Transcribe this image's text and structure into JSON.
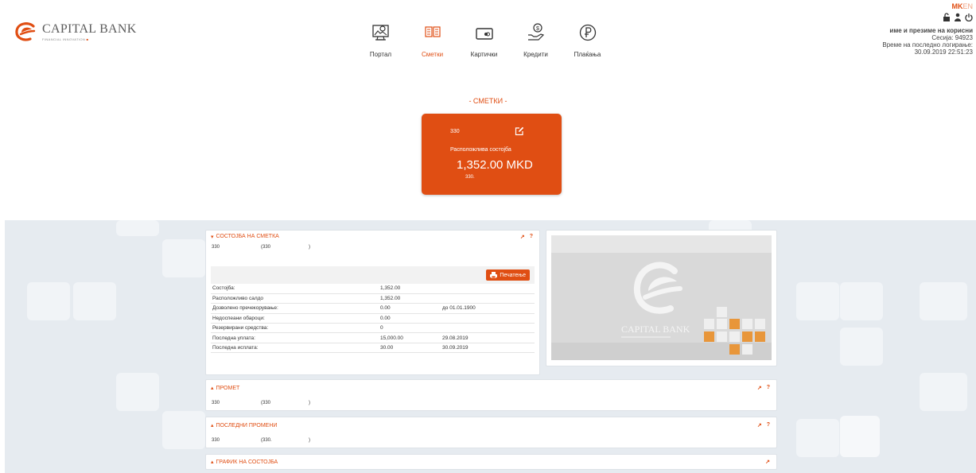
{
  "brand": {
    "name": "CAPITAL BANK",
    "tagline": "FINANCIAL INNOVATION",
    "accent": "#e04e13"
  },
  "nav": {
    "items": [
      {
        "label": "Портал",
        "icon": "portal-icon",
        "active": false
      },
      {
        "label": "Сметки",
        "icon": "accounts-icon",
        "active": true
      },
      {
        "label": "Картички",
        "icon": "card-icon",
        "active": false
      },
      {
        "label": "Кредити",
        "icon": "loan-icon",
        "active": false
      },
      {
        "label": "Плаќања",
        "icon": "payment-icon",
        "active": false
      }
    ]
  },
  "user": {
    "lang_mk": "MK",
    "lang_en": "EN",
    "name": "име и презиме на корисни",
    "session": "Сесија: 94923",
    "last_login_label": "Време на последно логирање:",
    "last_login_value": "30.09.2019 22:51:23"
  },
  "section_title": "- СМЕТКИ -",
  "account_card": {
    "number": "330",
    "label": "Расположлива состојба",
    "balance": "1,352.00 MKD",
    "sub": "330."
  },
  "balance_panel": {
    "title": "СОСТОЈБА НА СМЕТКА",
    "acct_1": "330",
    "acct_2": "(330",
    "acct_3": ")",
    "print_label": "Печатење",
    "rows": [
      {
        "label": "Состојба:",
        "value": "1,352.00",
        "extra": ""
      },
      {
        "label": "Расположливо салдо",
        "value": "1,352.00",
        "extra": ""
      },
      {
        "label": "Дозволено пречекорување:",
        "value": "0.00",
        "extra": "до 01.01.1900"
      },
      {
        "label": "Недоспеани обароци:",
        "value": "0.00",
        "extra": ""
      },
      {
        "label": "Резервирани средства:",
        "value": "0",
        "extra": ""
      },
      {
        "label": "Последна уплата:",
        "value": "15,000.00",
        "extra": "29.08.2019"
      },
      {
        "label": "Последна исплата:",
        "value": "30.00",
        "extra": "30.09.2019"
      }
    ]
  },
  "promet_panel": {
    "title": "ПРОМЕТ",
    "acct_1": "330",
    "acct_2": "(330",
    "acct_3": ")"
  },
  "changes_panel": {
    "title": "ПОСЛЕДНИ ПРОМЕНИ",
    "acct_1": "330",
    "acct_2": "(330.",
    "acct_3": ")"
  },
  "chart_panel": {
    "title": "ГРАФИК НА СОСТОЈБА"
  },
  "tools": {
    "expand": "↗",
    "help": "?"
  },
  "promo": {
    "brand": "CAPITAL BANK"
  }
}
